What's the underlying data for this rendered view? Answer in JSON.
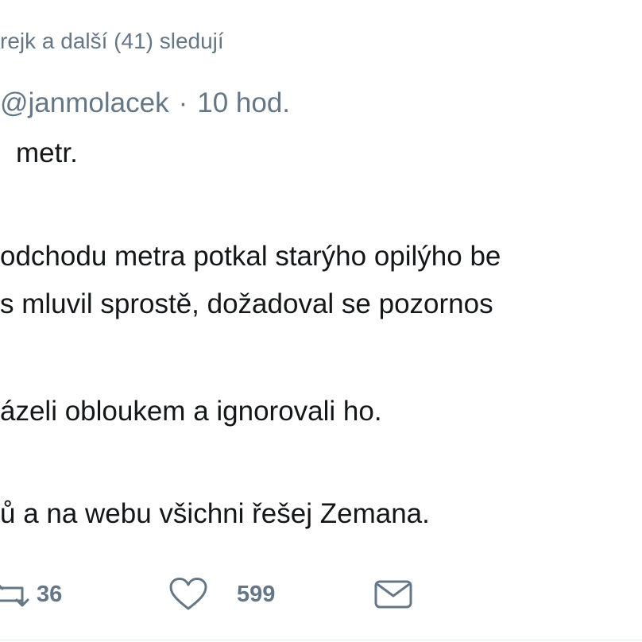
{
  "tweet": {
    "social_context": "rejk a další (41) sledují",
    "handle": "@janmolacek",
    "separator": "·",
    "time": "10 hod.",
    "body_lines": [
      "metr.",
      "odchodu metra potkal starýho opilýho be",
      "s mluvil sprostě, dožadoval se pozornos",
      "ázeli obloukem a ignorovali ho.",
      "ů a na webu všichni řešej Zemana."
    ],
    "actions": {
      "retweet_count": "36",
      "like_count": "599"
    }
  },
  "icons": {
    "retweet": "retweet-icon",
    "like": "heart-icon",
    "message": "envelope-icon"
  },
  "colors": {
    "text": "#14171a",
    "secondary": "#657786",
    "divider": "#e6ecf0"
  }
}
